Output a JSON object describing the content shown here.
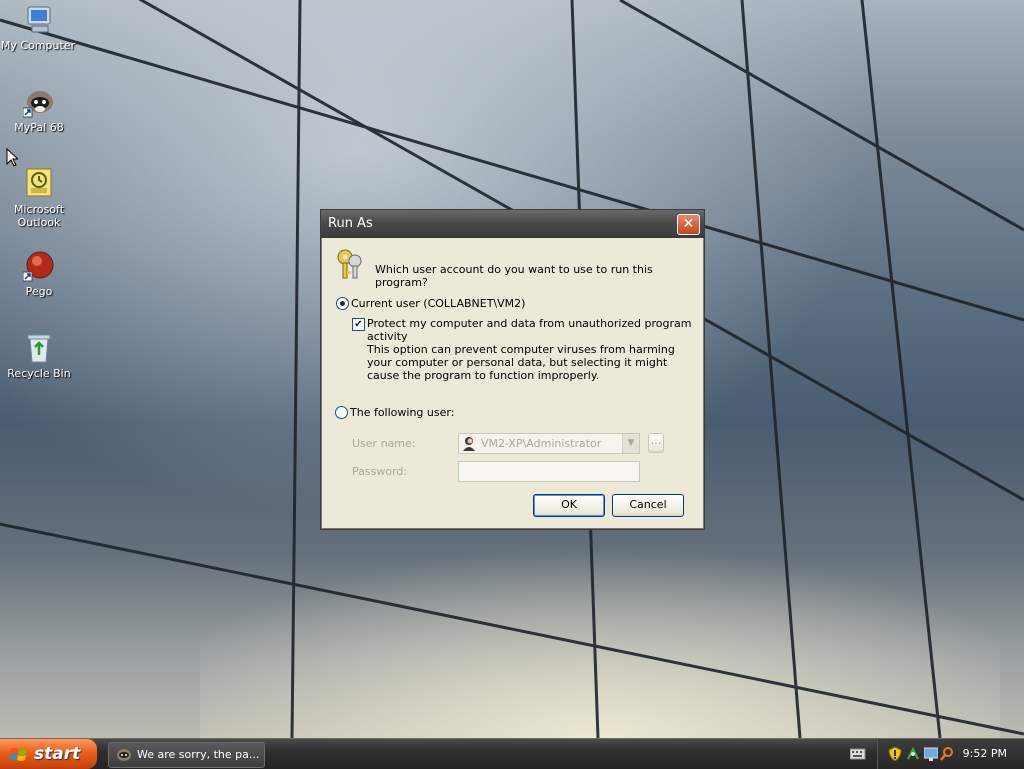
{
  "desktop": {
    "icons": [
      {
        "label": "My Computer"
      },
      {
        "label": "MyPal 68"
      },
      {
        "label": "Microsoft Outlook"
      },
      {
        "label": "Pego"
      },
      {
        "label": "Recycle Bin"
      }
    ]
  },
  "dialog": {
    "title": "Run As",
    "question": "Which user account do you want to use to run this program?",
    "current_user_label": "Current user (COLLABNET\\VM2)",
    "current_user_selected": true,
    "protect_label": "Protect my computer and data from unauthorized program activity",
    "protect_checked": true,
    "protect_description": "This option can prevent computer viruses from harming your computer or personal data, but selecting it might cause the program to function improperly.",
    "following_user_label": "The following user:",
    "following_user_selected": false,
    "username_label": "User name:",
    "username_value": "VM2-XP\\Administrator",
    "browse_label": "...",
    "password_label": "Password:",
    "password_value": "",
    "ok_label": "OK",
    "cancel_label": "Cancel",
    "close_glyph": "✕"
  },
  "taskbar": {
    "start_label": "start",
    "task_label": "We are sorry, the pa...",
    "clock": "9:52 PM"
  },
  "colors": {
    "titlebar": "#4a4a4a",
    "start": "#e95f1c",
    "dialog_bg": "#ece9d8"
  }
}
